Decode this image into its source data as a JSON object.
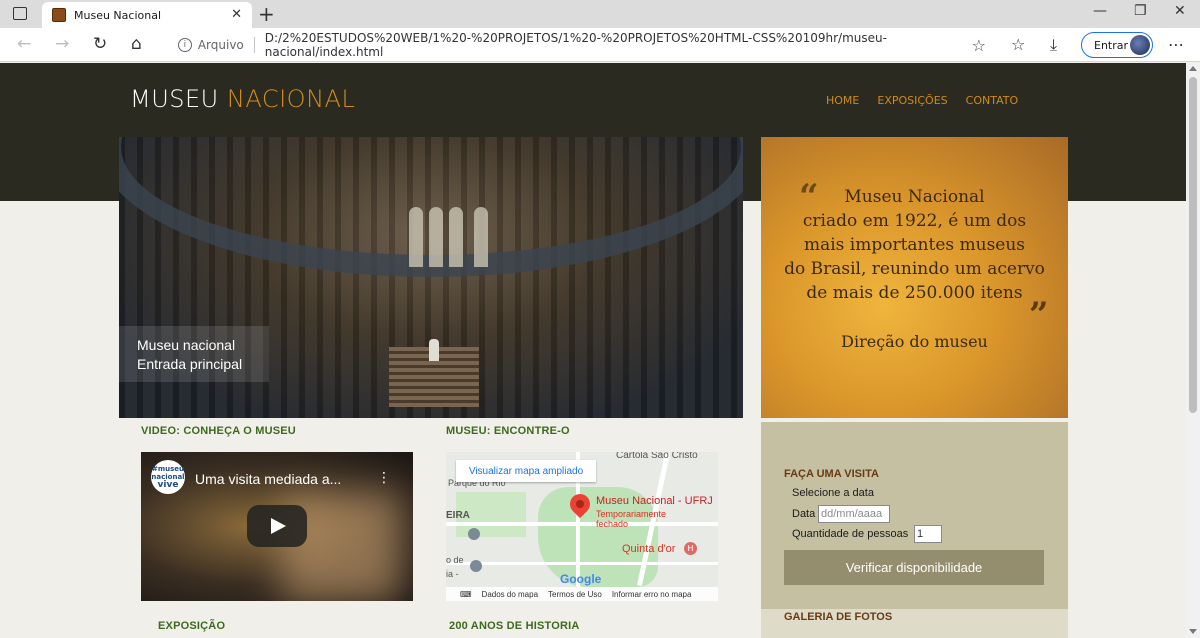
{
  "browser": {
    "tab_title": "Museu Nacional",
    "url_protocol": "Arquivo",
    "url": "D:/2%20ESTUDOS%20WEB/1%20-%20PROJETOS/1%20-%20PROJETOS%20HTML-CSS%20109hr/museu-nacional/index.html",
    "signin_label": "Entrar"
  },
  "header": {
    "logo_part1": "MUSEU",
    "logo_part2": "NACIONAL",
    "nav": [
      "HOME",
      "EXPOSIÇÕES",
      "CONTATO"
    ]
  },
  "hero": {
    "caption_line1": "Museu nacional",
    "caption_line2": "Entrada principal"
  },
  "quote": {
    "line1": "Museu Nacional",
    "line2": "criado em 1922, é um dos",
    "line3": "mais importantes museus",
    "line4": "do Brasil, reunindo um acervo",
    "line5": "de mais de 250.000 itens",
    "author": "Direção do museu",
    "open_mark": "“",
    "close_mark": "”"
  },
  "sections": {
    "video_title": "VIDEO: CONHEÇA O MUSEU",
    "map_title": "MUSEU: ENCONTRE-O",
    "exposicao_title": "EXPOSIÇÃO",
    "historia_title": "200 ANOS DE HISTORIA"
  },
  "video": {
    "channel_line1": "#museu",
    "channel_line2": "nacional",
    "channel_line3": "vive",
    "title": "Uma visita mediada a...",
    "menu_glyph": "⋮"
  },
  "map": {
    "expand_label": "Visualizar mapa ampliado",
    "top_label": "Cartola São Cristó",
    "parque_label": "Parque do Rio",
    "side_label1": "EIRA",
    "side_label2": "o de",
    "side_label3": "ia -",
    "pin_title": "Museu Nacional - UFRJ",
    "pin_sub1": "Temporariamente",
    "pin_sub2": "fechado",
    "poi": "Quinta d'or",
    "poi_icon": "H",
    "google": "Google",
    "footer": [
      "Dados do mapa",
      "Termos de Uso",
      "Informar erro no mapa"
    ],
    "keyboard_icon": "⌨"
  },
  "visit": {
    "title": "FAÇA UMA VISITA",
    "select_label": "Selecione a data",
    "date_label": "Data",
    "date_placeholder": "dd/mm/aaaa",
    "qty_label": "Quantidade de pessoas",
    "qty_value": "1",
    "button": "Verificar disponibilidade"
  },
  "gallery": {
    "title": "GALERIA DE FOTOS"
  },
  "colors": {
    "header_bg": "#2b2a20",
    "accent_orange": "#d28c1e",
    "section_green": "#3d6a1e",
    "panel_bg": "#c5c0a2",
    "button_bg": "#958e6e"
  }
}
